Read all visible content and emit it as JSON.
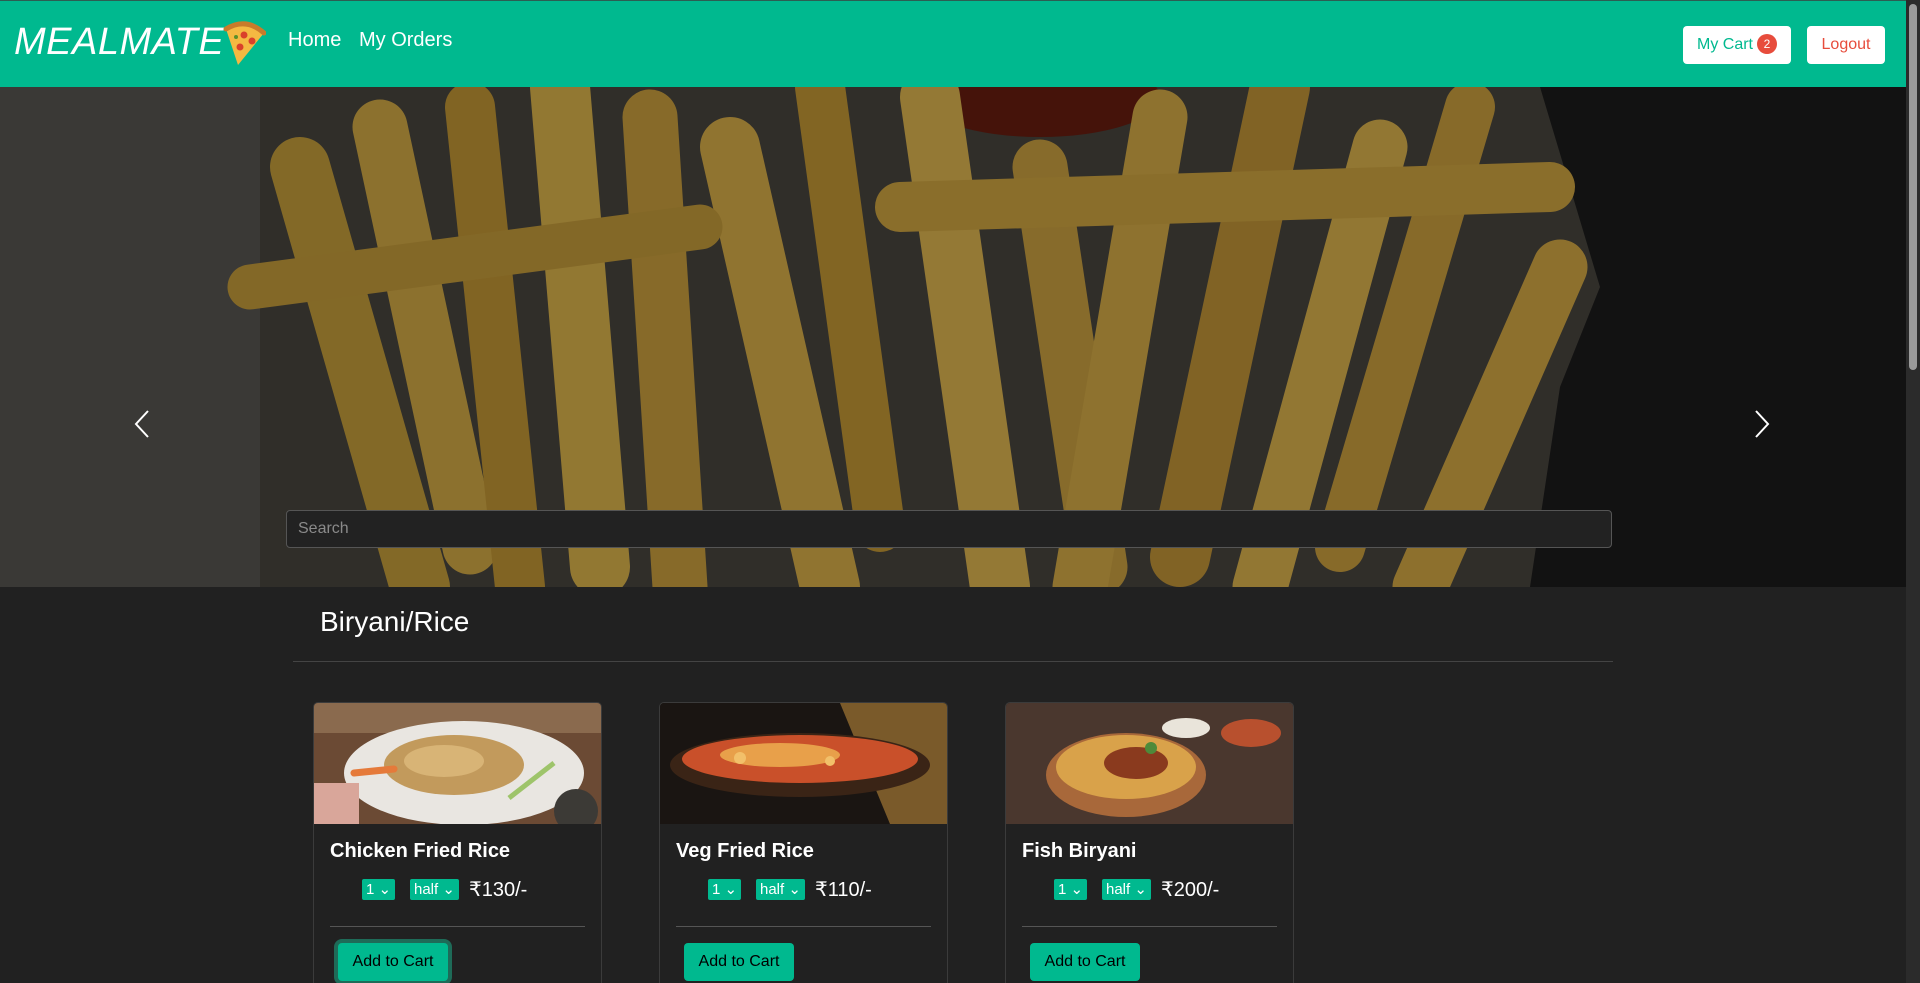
{
  "nav": {
    "brand": "MEALMATE",
    "links": [
      "Home",
      "My Orders"
    ],
    "cart_label": "My Cart",
    "cart_count": "2",
    "logout_label": "Logout"
  },
  "hero": {
    "search_placeholder": "Search"
  },
  "section": {
    "title": "Biryani/Rice"
  },
  "items": [
    {
      "name": "Chicken Fried Rice",
      "qty": "1",
      "size": "half",
      "price": "₹130/-",
      "button": "Add to Cart"
    },
    {
      "name": "Veg Fried Rice",
      "qty": "1",
      "size": "half",
      "price": "₹110/-",
      "button": "Add to Cart"
    },
    {
      "name": "Fish Biryani",
      "qty": "1",
      "size": "half",
      "price": "₹200/-",
      "button": "Add to Cart"
    }
  ],
  "colors": {
    "accent": "#00b98f",
    "background": "#212121",
    "danger": "#e74c3c"
  }
}
